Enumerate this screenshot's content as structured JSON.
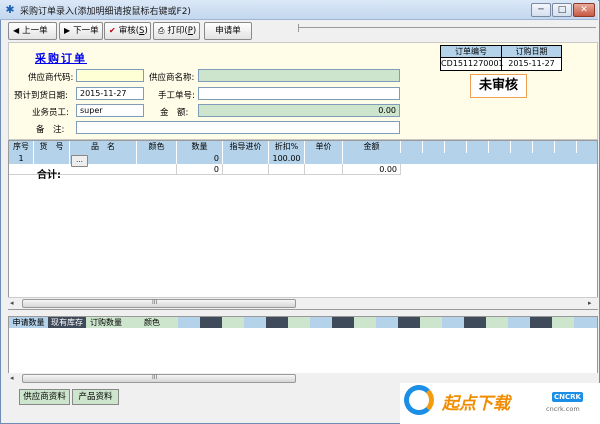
{
  "window": {
    "title": "采购订单录入(添加明细请按鼠标右键或F2)",
    "min": "─",
    "max": "□",
    "close": "✕",
    "app_icon": "✱"
  },
  "toolbar": {
    "prev": "上一单",
    "next": "下一单",
    "audit": "审核(",
    "audit_key": "S",
    "print": "打印(",
    "print_key": "P",
    "apply": "申请单",
    "icons": {
      "prev": "triangle-left-icon",
      "next": "triangle-right-icon",
      "audit": "checkmark-icon",
      "print": "printer-icon"
    }
  },
  "header": {
    "form_title": "采购订单",
    "supplier_code_label": "供应商代码:",
    "supplier_code": "",
    "supplier_name_label": "供应商名称:",
    "supplier_name": "",
    "expected_date_label": "预计到货日期:",
    "expected_date": "2015-11-27",
    "manual_no_label": "手工单号:",
    "manual_no": "",
    "staff_label": "业务员工:",
    "staff": "super",
    "amount_label": "金　额:",
    "amount": "0.00",
    "remark_label": "备　注:",
    "remark": ""
  },
  "order_info": {
    "no_label": "订单编号",
    "date_label": "订购日期",
    "no": "CD1511270001",
    "date": "2015-11-27",
    "status": "未审核"
  },
  "grid": {
    "columns": [
      "序号",
      "货　号",
      "品　名",
      "颜色",
      "数量",
      "指导进价",
      "折扣%",
      "单价",
      "金额"
    ],
    "row": {
      "index": "1",
      "qty": "0",
      "discount": "100.00"
    },
    "total": {
      "label": "合计:",
      "qty": "0",
      "amount": "0.00"
    },
    "scroll_grip": "III"
  },
  "lower_grid": {
    "columns": [
      "申请数量",
      "现有库存",
      "订购数量",
      "颜色"
    ],
    "scroll_grip": "III"
  },
  "footer": {
    "supplier_btn": "供应商资料",
    "product_btn": "产品资料"
  },
  "watermark": {
    "text": "起点下载",
    "badge": "CNCRK",
    "url": "cncrk.com"
  },
  "colors": {
    "accent_blue": "#b4d3ea",
    "green_field": "#cde5cd",
    "yellow_panel": "#fffde8",
    "link_blue": "#0000ee"
  }
}
